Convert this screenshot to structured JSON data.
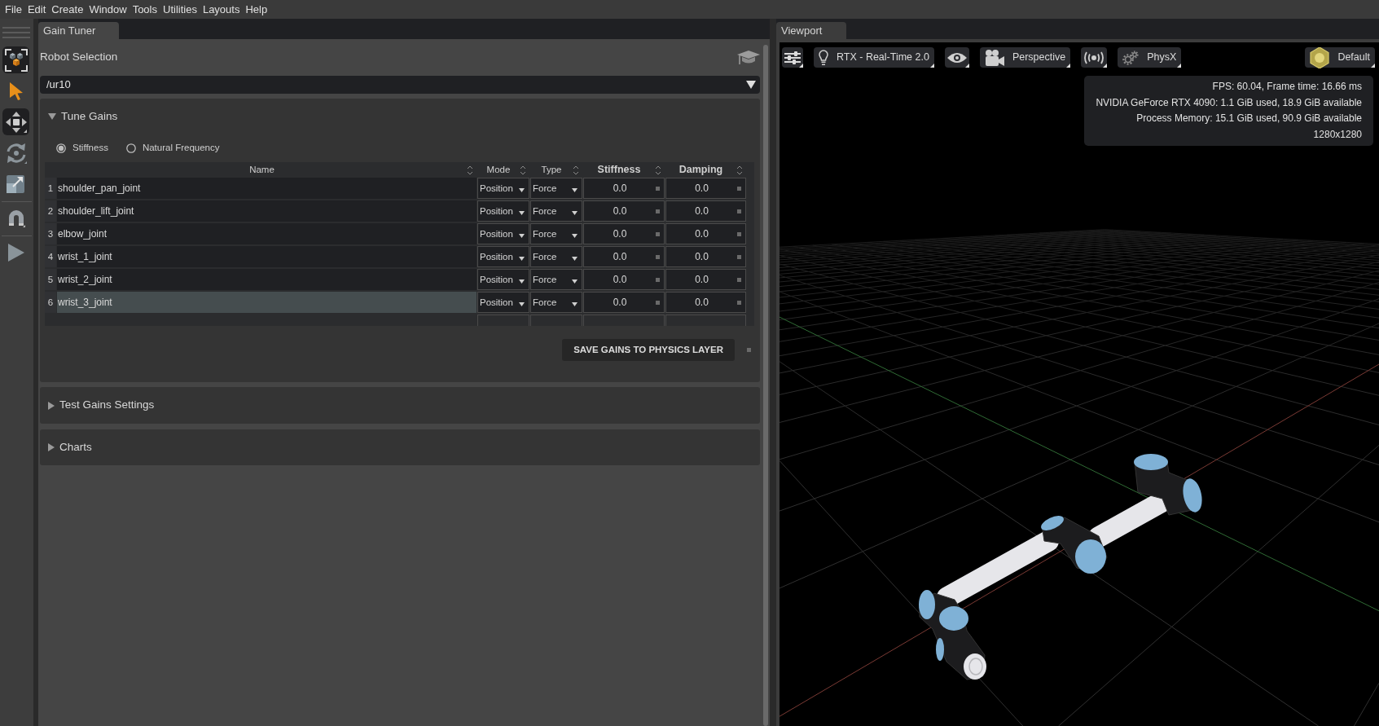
{
  "menu_bar": {
    "items": [
      "File",
      "Edit",
      "Create",
      "Window",
      "Tools",
      "Utilities",
      "Layouts",
      "Help"
    ]
  },
  "toolbar": {
    "groups": [
      {
        "tools": [
          {
            "kind": "selection-mode",
            "selected": true
          },
          {
            "kind": "select",
            "selected": false
          },
          {
            "kind": "move",
            "selected": true
          },
          {
            "kind": "rotate",
            "selected": false
          },
          {
            "kind": "scale",
            "selected": false
          }
        ]
      },
      {
        "tools": [
          {
            "kind": "snap",
            "selected": false
          }
        ]
      },
      {
        "tools": [
          {
            "kind": "play",
            "selected": false
          }
        ]
      }
    ]
  },
  "gain_tuner": {
    "tab": {
      "label": "Gain Tuner",
      "selected": true
    },
    "robot_selection": {
      "label": "Robot Selection",
      "value": "/ur10"
    },
    "tune_gains": {
      "title": "Tune Gains",
      "expanded": true,
      "options": [
        {
          "label": "Stiffness",
          "selected": true
        },
        {
          "label": "Natural Frequency",
          "selected": false
        }
      ],
      "table": {
        "columns": [
          "Name",
          "Mode",
          "Type",
          "Stiffness",
          "Damping"
        ],
        "rows": [
          {
            "number": "1",
            "name": "shoulder_pan_joint",
            "mode": "Position",
            "type": "Force",
            "stiffness": "0.0",
            "damping": "0.0",
            "selected": false
          },
          {
            "number": "2",
            "name": "shoulder_lift_joint",
            "mode": "Position",
            "type": "Force",
            "stiffness": "0.0",
            "damping": "0.0",
            "selected": false
          },
          {
            "number": "3",
            "name": "elbow_joint",
            "mode": "Position",
            "type": "Force",
            "stiffness": "0.0",
            "damping": "0.0",
            "selected": false
          },
          {
            "number": "4",
            "name": "wrist_1_joint",
            "mode": "Position",
            "type": "Force",
            "stiffness": "0.0",
            "damping": "0.0",
            "selected": false
          },
          {
            "number": "5",
            "name": "wrist_2_joint",
            "mode": "Position",
            "type": "Force",
            "stiffness": "0.0",
            "damping": "0.0",
            "selected": false
          },
          {
            "number": "6",
            "name": "wrist_3_joint",
            "mode": "Position",
            "type": "Force",
            "stiffness": "0.0",
            "damping": "0.0",
            "selected": true
          }
        ]
      },
      "save_button": {
        "label": "SAVE GAINS TO PHYSICS LAYER"
      }
    },
    "sections": [
      {
        "title": "Test Gains Settings",
        "expanded": false
      },
      {
        "title": "Charts",
        "expanded": false
      }
    ]
  },
  "viewport": {
    "tab": {
      "label": "Viewport",
      "selected": true
    },
    "toolbar": {
      "left": [
        {
          "kind": "settings"
        },
        {
          "kind": "renderer",
          "label": "RTX - Real-Time 2.0"
        },
        {
          "kind": "visibility"
        },
        {
          "kind": "camera",
          "label": "Perspective"
        },
        {
          "kind": "broadcast"
        },
        {
          "kind": "physics",
          "label": "PhysX"
        }
      ],
      "right": [
        {
          "kind": "lighting",
          "label": "Default"
        }
      ]
    },
    "stats": [
      "FPS: 60.04, Frame time: 16.66 ms",
      "NVIDIA GeForce RTX 4090: 1.1 GiB used, 18.9 GiB available",
      "Process Memory: 15.1 GiB used, 90.9 GiB available",
      "1280x1280"
    ]
  }
}
